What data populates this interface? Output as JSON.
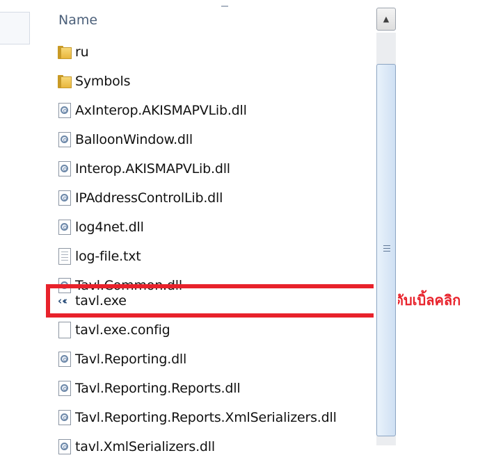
{
  "header": {
    "name_column": "Name"
  },
  "files": [
    {
      "name": "ru",
      "icon": "folder-icon"
    },
    {
      "name": "Symbols",
      "icon": "folder-icon"
    },
    {
      "name": "AxInterop.AKISMAPVLib.dll",
      "icon": "dll-icon"
    },
    {
      "name": "BalloonWindow.dll",
      "icon": "dll-icon"
    },
    {
      "name": "Interop.AKISMAPVLib.dll",
      "icon": "dll-icon"
    },
    {
      "name": "IPAddressControlLib.dll",
      "icon": "dll-icon"
    },
    {
      "name": "log4net.dll",
      "icon": "dll-icon"
    },
    {
      "name": "log-file.txt",
      "icon": "text-file-icon"
    },
    {
      "name": "Tavl.Common.dll",
      "icon": "dll-icon"
    },
    {
      "name": "tavl.exe",
      "icon": "exe-icon"
    },
    {
      "name": "tavl.exe.config",
      "icon": "blank-file-icon"
    },
    {
      "name": "Tavl.Reporting.dll",
      "icon": "dll-icon"
    },
    {
      "name": "Tavl.Reporting.Reports.dll",
      "icon": "dll-icon"
    },
    {
      "name": "Tavl.Reporting.Reports.XmlSerializers.dll",
      "icon": "dll-icon"
    },
    {
      "name": "tavl.XmlSerializers.dll",
      "icon": "dll-icon"
    }
  ],
  "annotation": {
    "text": "ดับเบิ้ลคลิก",
    "color": "#e8222b"
  }
}
